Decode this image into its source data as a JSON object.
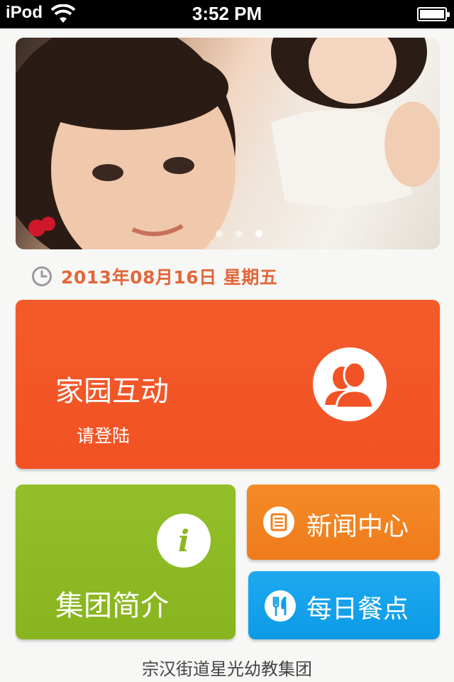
{
  "status_bar": {
    "carrier": "iPod",
    "time": "3:52 PM"
  },
  "banner": {
    "slide_count": 3,
    "active_slide": 3
  },
  "date": {
    "text": "2013年08月16日 星期五"
  },
  "tiles": {
    "home_interaction": {
      "title": "家园互动",
      "subtitle": "请登陆",
      "icon": "user-icon"
    },
    "group_intro": {
      "title": "集团简介",
      "icon": "info-icon"
    },
    "news_center": {
      "title": "新闻中心",
      "icon": "news-icon"
    },
    "daily_meal": {
      "title": "每日餐点",
      "icon": "fork-knife-icon"
    }
  },
  "footer": {
    "text": "宗汉街道星光幼教集团"
  },
  "colors": {
    "date": "#e2673b",
    "home_tile": "#f35b2a",
    "about_tile": "#8fbb25",
    "news_tile": "#f2831f",
    "meal_tile": "#14a2ec"
  }
}
